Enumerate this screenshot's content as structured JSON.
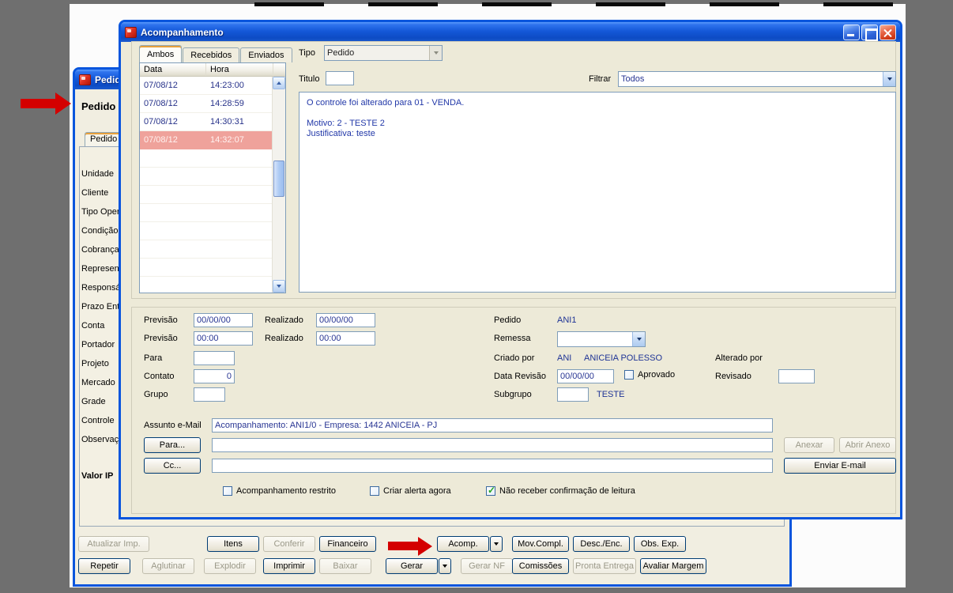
{
  "acomp": {
    "title": "Acompanhamento",
    "tabs": {
      "ambos": "Ambos",
      "recebidos": "Recebidos",
      "enviados": "Enviados"
    },
    "list": {
      "col_data": "Data",
      "col_hora": "Hora",
      "rows": [
        {
          "data": "07/08/12",
          "hora": "14:23:00"
        },
        {
          "data": "07/08/12",
          "hora": "14:28:59"
        },
        {
          "data": "07/08/12",
          "hora": "14:30:31"
        },
        {
          "data": "07/08/12",
          "hora": "14:32:07"
        }
      ],
      "selected_row": 3
    },
    "filters": {
      "tipo_label": "Tipo",
      "tipo_value": "Pedido",
      "titulo_label": "Titulo",
      "titulo_value": "",
      "filtrar_label": "Filtrar",
      "filtrar_value": "Todos"
    },
    "message": {
      "line1": "O controle foi alterado para 01 - VENDA.",
      "line2": "Motivo: 2 - TESTE 2",
      "line3": "Justificativa: teste"
    },
    "detail": {
      "previsao_label": "Previsão",
      "previsao_data": "00/00/00",
      "previsao_hora": "00:00",
      "realizado_label": "Realizado",
      "realizado_data": "00/00/00",
      "realizado_hora": "00:00",
      "para_label": "Para",
      "para_value": "",
      "contato_label": "Contato",
      "contato_value": "0",
      "grupo_label": "Grupo",
      "grupo_value": "",
      "pedido_label": "Pedido",
      "pedido_value": "ANI1",
      "remessa_label": "Remessa",
      "remessa_value": "",
      "criado_por_label": "Criado por",
      "criado_por_code": "ANI",
      "criado_por_name": "ANICEIA POLESSO",
      "alterado_por_label": "Alterado por",
      "data_revisao_label": "Data Revisão",
      "data_revisao_value": "00/00/00",
      "aprovado_label": "Aprovado",
      "aprovado_checked": false,
      "revisado_label": "Revisado",
      "revisado_value": "",
      "subgrupo_label": "Subgrupo",
      "subgrupo_value": "",
      "subgrupo_name": "TESTE"
    },
    "email": {
      "assunto_label": "Assunto e-Mail",
      "assunto_value": "Acompanhamento: ANI1/0 - Empresa: 1442 ANICEIA - PJ",
      "para_btn": "Para...",
      "para_value": "",
      "cc_btn": "Cc...",
      "cc_value": "",
      "anexar_btn": "Anexar",
      "abrir_anexo_btn": "Abrir Anexo",
      "enviar_btn": "Enviar E-mail",
      "cb_restrito": "Acompanhamento restrito",
      "cb_restrito_checked": false,
      "cb_alerta": "Criar alerta agora",
      "cb_alerta_checked": false,
      "cb_leitura": "Não receber confirmação de leitura",
      "cb_leitura_checked": true
    }
  },
  "pedido": {
    "title": "Pedido",
    "heading": "Pedido",
    "tab_label": "Pedido",
    "labels": [
      "Unidade",
      "Cliente",
      "Tipo Oper",
      "Condição",
      "Cobrança",
      "Represen",
      "Responsá",
      "Prazo Entr",
      "Conta",
      "Portador",
      "Projeto",
      "Mercado",
      "Grade",
      "Controle",
      "Observaç"
    ],
    "footer_label": "Valor IP"
  },
  "toolbar": {
    "row1": [
      {
        "label": "Atualizar Imp.",
        "disabled": true
      },
      {
        "label": "Itens",
        "disabled": false
      },
      {
        "label": "Conferir",
        "disabled": true
      },
      {
        "label": "Financeiro",
        "disabled": false
      },
      {
        "label": "Acomp.",
        "disabled": false,
        "dropdown": true
      },
      {
        "label": "Mov.Compl.",
        "disabled": false
      },
      {
        "label": "Desc./Enc.",
        "disabled": false
      },
      {
        "label": "Obs. Exp.",
        "disabled": false
      }
    ],
    "row2": [
      {
        "label": "Repetir",
        "disabled": false
      },
      {
        "label": "Aglutinar",
        "disabled": true
      },
      {
        "label": "Explodir",
        "disabled": true
      },
      {
        "label": "Imprimir",
        "disabled": false
      },
      {
        "label": "Baixar",
        "disabled": true
      },
      {
        "label": "Gerar",
        "disabled": false,
        "dropdown": true
      },
      {
        "label": "Gerar NF",
        "disabled": true
      },
      {
        "label": "Comissões",
        "disabled": false
      },
      {
        "label": "Pronta Entrega",
        "disabled": true
      },
      {
        "label": "Avaliar Margem",
        "disabled": false
      }
    ]
  },
  "colors": {
    "titlebar_blue": "#1458D8",
    "window_border": "#0855DD",
    "selected_row_bg": "#EFA29B",
    "message_text": "#2238A8",
    "arrow_red": "#D40000",
    "check_green": "#23A61F"
  }
}
